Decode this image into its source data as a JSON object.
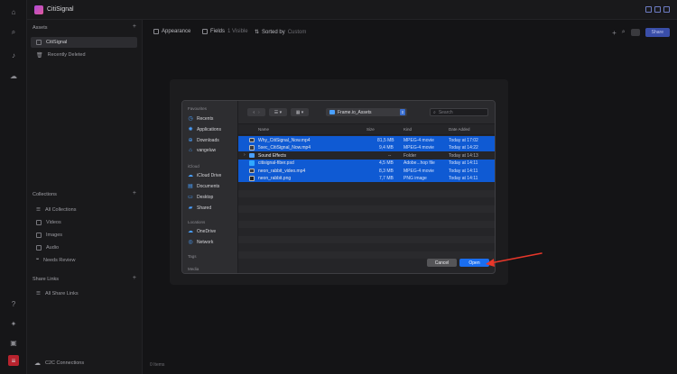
{
  "app": {
    "title": "CitiSignal"
  },
  "sidebar": {
    "assets_header": "Assets",
    "assets": [
      {
        "label": "CitiSignal",
        "active": true
      },
      {
        "label": "Recently Deleted",
        "active": false
      }
    ],
    "collections_header": "Collections",
    "collections": [
      {
        "label": "All Collections"
      },
      {
        "label": "Videos"
      },
      {
        "label": "Images"
      },
      {
        "label": "Audio"
      },
      {
        "label": "Needs Review"
      }
    ],
    "share_header": "Share Links",
    "share_links": [
      {
        "label": "All Share Links"
      }
    ],
    "footer": "C2C Connections"
  },
  "toolbar": {
    "appearance": "Appearance",
    "fields": "Fields",
    "fields_count": "1 Visible",
    "sorted_by": "Sorted by",
    "sort_value": "Custom",
    "share_label": "Share"
  },
  "status": {
    "items": "0 Items"
  },
  "dialog": {
    "favourites_header": "Favourites",
    "favourites": [
      {
        "label": "Recents",
        "icon": "clock-icon"
      },
      {
        "label": "Applications",
        "icon": "applications-icon"
      },
      {
        "label": "Downloads",
        "icon": "download-icon"
      },
      {
        "label": "vangeluw",
        "icon": "home-icon"
      }
    ],
    "icloud_header": "iCloud",
    "icloud": [
      {
        "label": "iCloud Drive",
        "icon": "cloud-icon"
      },
      {
        "label": "Documents",
        "icon": "document-icon"
      },
      {
        "label": "Desktop",
        "icon": "desktop-icon"
      },
      {
        "label": "Shared",
        "icon": "shared-folder-icon"
      }
    ],
    "locations_header": "Locations",
    "locations": [
      {
        "label": "OneDrive",
        "icon": "cloud-icon"
      },
      {
        "label": "Network",
        "icon": "network-icon"
      }
    ],
    "tags_header": "Tags",
    "media_header": "Media",
    "location": "Frame.io_Assets",
    "search_placeholder": "Search",
    "columns": {
      "name": "Name",
      "size": "Size",
      "kind": "Kind",
      "date": "Date Added"
    },
    "files": [
      {
        "name": "Why_CitiSignal_Now.mp4",
        "size": "81,5 MB",
        "kind": "MPEG-4 movie",
        "date": "Today at 17:02",
        "selected": true,
        "type": "video"
      },
      {
        "name": "5sec_CitiSignal_Now.mp4",
        "size": "9,4 MB",
        "kind": "MPEG-4 movie",
        "date": "Today at 14:22",
        "selected": true,
        "type": "video"
      },
      {
        "name": "Sound Effects",
        "size": "--",
        "kind": "Folder",
        "date": "Today at 14:13",
        "selected": false,
        "type": "folder"
      },
      {
        "name": "citisignal-fiber.psd",
        "size": "4,5 MB",
        "kind": "Adobe...hop file",
        "date": "Today at 14:11",
        "selected": true,
        "type": "psd"
      },
      {
        "name": "neon_rabbit_video.mp4",
        "size": "8,3 MB",
        "kind": "MPEG-4 movie",
        "date": "Today at 14:11",
        "selected": true,
        "type": "video"
      },
      {
        "name": "neon_rabbit.png",
        "size": "7,7 MB",
        "kind": "PNG image",
        "date": "Today at 14:11",
        "selected": true,
        "type": "image"
      }
    ],
    "cancel_label": "Cancel",
    "open_label": "Open"
  },
  "colors": {
    "selection": "#0f5ad3",
    "accent": "#1a6ef0",
    "annotation_arrow": "#e8372a"
  }
}
